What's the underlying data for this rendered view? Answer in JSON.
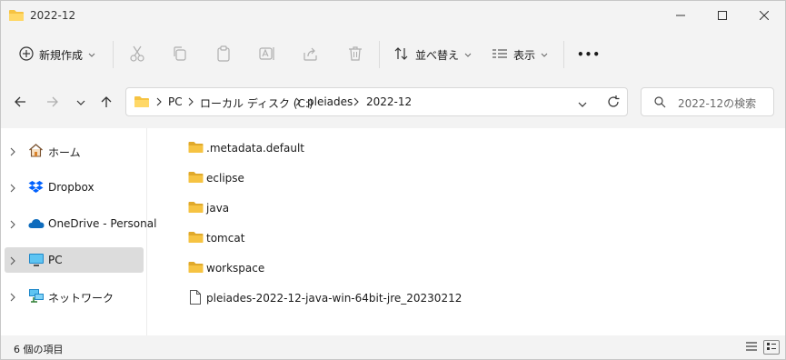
{
  "window": {
    "title": "2022-12"
  },
  "toolbar": {
    "new_label": "新規作成",
    "sort_label": "並べ替え",
    "view_label": "表示",
    "more_label": "•••"
  },
  "address": {
    "crumbs": [
      "PC",
      "ローカル ディスク (C:)",
      "pleiades",
      "2022-12"
    ]
  },
  "search": {
    "placeholder": "2022-12の検索"
  },
  "nav": {
    "items": [
      {
        "label": "ホーム",
        "icon": "home-icon"
      },
      {
        "label": "Dropbox",
        "icon": "dropbox-icon"
      },
      {
        "label": "OneDrive - Personal",
        "icon": "onedrive-icon"
      },
      {
        "label": "PC",
        "icon": "pc-icon"
      },
      {
        "label": "ネットワーク",
        "icon": "network-icon"
      }
    ]
  },
  "files": {
    "items": [
      {
        "name": ".metadata.default",
        "type": "folder"
      },
      {
        "name": "eclipse",
        "type": "folder"
      },
      {
        "name": "java",
        "type": "folder"
      },
      {
        "name": "tomcat",
        "type": "folder"
      },
      {
        "name": "workspace",
        "type": "folder"
      },
      {
        "name": "pleiades-2022-12-java-win-64bit-jre_20230212",
        "type": "file"
      }
    ]
  },
  "status": {
    "item_count": "6 個の項目"
  },
  "colors": {
    "folder": "#f6c342",
    "folder_dark": "#e0a92a",
    "accent": "#0067c0",
    "selection": "#dcdcdc"
  }
}
